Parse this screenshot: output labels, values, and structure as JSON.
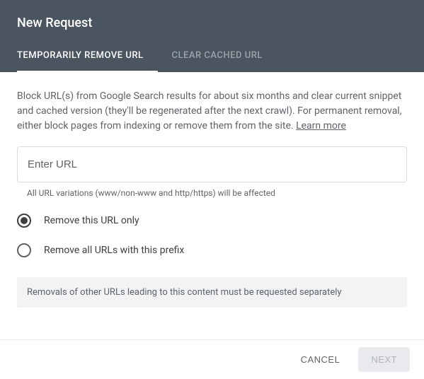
{
  "header": {
    "title": "New Request"
  },
  "tabs": [
    {
      "label": "TEMPORARILY REMOVE URL",
      "active": true
    },
    {
      "label": "CLEAR CACHED URL",
      "active": false
    }
  ],
  "content": {
    "description": "Block URL(s) from Google Search results for about six months and clear current snippet and cached version (they'll be regenerated after the next crawl). For permanent removal, either block pages from indexing or remove them from the site. ",
    "learn_more": "Learn more",
    "url_placeholder": "Enter URL",
    "url_hint": "All URL variations (www/non-www and http/https) will be affected",
    "radio_options": [
      {
        "label": "Remove this URL only",
        "checked": true
      },
      {
        "label": "Remove all URLs with this prefix",
        "checked": false
      }
    ],
    "notice": "Removals of other URLs leading to this content must be requested separately"
  },
  "footer": {
    "cancel_label": "CANCEL",
    "next_label": "NEXT"
  }
}
